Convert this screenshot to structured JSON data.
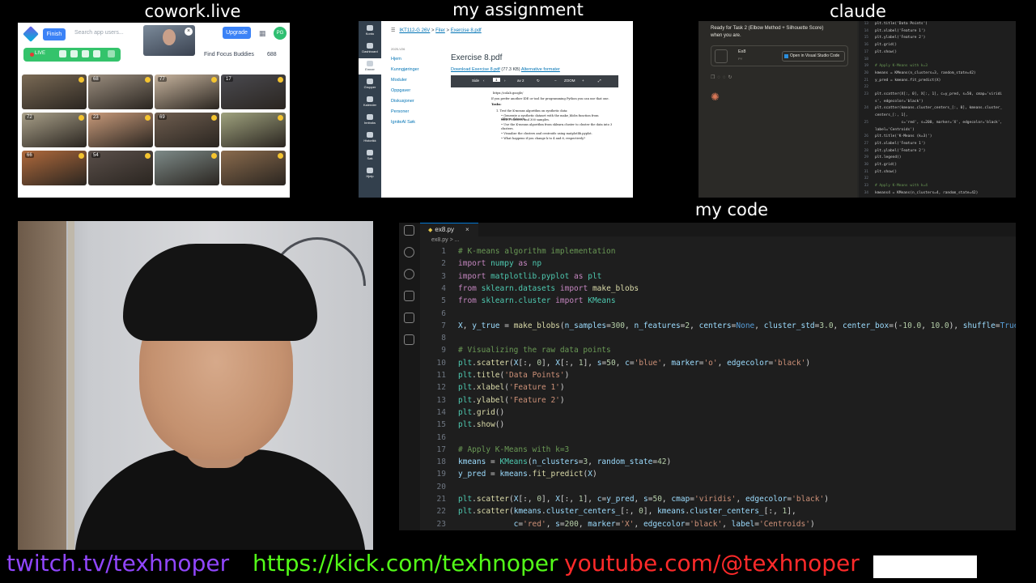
{
  "labels": {
    "cowork": "cowork.live",
    "assignment": "my assignment",
    "claude": "claude",
    "code": "my code"
  },
  "cowork": {
    "finish": "Finish",
    "search_placeholder": "Search app users...",
    "upgrade": "Upgrade",
    "avatar": "PG",
    "live": "LIVE",
    "find": "Find Focus Buddies",
    "count": "688",
    "tiles": [
      {
        "badge": "",
        "bg": "#7a6a55"
      },
      {
        "badge": "68",
        "bg": "#9a8d7e"
      },
      {
        "badge": "77",
        "bg": "#c7b49e"
      },
      {
        "badge": "17",
        "bg": "#4a4a50"
      },
      {
        "badge": "72",
        "bg": "#a9a089"
      },
      {
        "badge": "23",
        "bg": "#c89a7a"
      },
      {
        "badge": "69",
        "bg": "#6e5d4f"
      },
      {
        "badge": "",
        "bg": "#9fa27e"
      },
      {
        "badge": "66",
        "bg": "#b06a3c"
      },
      {
        "badge": "54",
        "bg": "#5a4f4a"
      },
      {
        "badge": "",
        "bg": "#7d8a88"
      },
      {
        "badge": "",
        "bg": "#8a6b4d"
      }
    ]
  },
  "assignment": {
    "sidebar": [
      "Konto",
      "Dashboard",
      "Emner",
      "Grupper",
      "Kalender",
      "Innboks",
      "Historikk",
      "Søk",
      "Hjelp"
    ],
    "breadcrumb": [
      "IKT112-G 26V",
      "Filer",
      "Exercise 8.pdf"
    ],
    "year": "2025-V26",
    "nav": [
      "Hjem",
      "Kunngjøringer",
      "Moduler",
      "Oppgaver",
      "Diskusjoner",
      "Personer",
      "IgniteAI Søk"
    ],
    "title": "Exercise 8.pdf",
    "download": "Download Exercise 8.pdf",
    "size": "(77.3 KB)",
    "alt": "Alternative formater",
    "pdf_side": "Side",
    "pdf_page": "1",
    "pdf_of": "av 2",
    "pdf_zoom": "ZOOM",
    "pdf_lines": [
      "https://colab.google/",
      "If you prefer another IDE or tool for programming Python you can use that one.",
      "Tasks:",
      "1. Test the K-means algorithm on synthetic data:",
      "• Generate a synthetic dataset with the make_blobs function from sklearn.datasets",
      "  with 3 clusters and 300 samples.",
      "• Use the K-means algorithm from sklearn.cluster to cluster the data into 3",
      "  clusters.",
      "• Visualize the clusters and centroids using matplotlib.pyplot.",
      "• What happens if you change k to 4 and 6, respectively?"
    ]
  },
  "claude": {
    "text1": "Ready for Task 2 (Elbow Method + Silhouette Score)",
    "text2": "when you are.",
    "file_name": "Ex8",
    "file_type": "PY",
    "open_btn": "Open in Visual Studio Code",
    "code_lines": [
      {
        "n": "13",
        "t": "plt.title('Data Points')"
      },
      {
        "n": "14",
        "t": "plt.xlabel('Feature 1')"
      },
      {
        "n": "15",
        "t": "plt.ylabel('Feature 2')"
      },
      {
        "n": "16",
        "t": "plt.grid()"
      },
      {
        "n": "17",
        "t": "plt.show()"
      },
      {
        "n": "18",
        "t": ""
      },
      {
        "n": "19",
        "t": "# Apply K-Means with k=3"
      },
      {
        "n": "20",
        "t": "kmeans = KMeans(n_clusters=3, random_state=42)"
      },
      {
        "n": "21",
        "t": "y_pred = kmeans.fit_predict(X)"
      },
      {
        "n": "22",
        "t": ""
      },
      {
        "n": "23",
        "t": "plt.scatter(X[:, 0], X[:, 1], c=y_pred, s=50, cmap='viridi"
      },
      {
        "n": "",
        "t": "s', edgecolor='black')"
      },
      {
        "n": "24",
        "t": "plt.scatter(kmeans.cluster_centers_[:, 0], kmeans.cluster_"
      },
      {
        "n": "",
        "t": "centers_[:, 1],"
      },
      {
        "n": "25",
        "t": "            c='red', s=200, marker='X', edgecolor='black',"
      },
      {
        "n": "",
        "t": "label='Centroids')"
      },
      {
        "n": "26",
        "t": "plt.title('K-Means (k=3)')"
      },
      {
        "n": "27",
        "t": "plt.xlabel('Feature 1')"
      },
      {
        "n": "28",
        "t": "plt.ylabel('Feature 2')"
      },
      {
        "n": "29",
        "t": "plt.legend()"
      },
      {
        "n": "30",
        "t": "plt.grid()"
      },
      {
        "n": "31",
        "t": "plt.show()"
      },
      {
        "n": "32",
        "t": ""
      },
      {
        "n": "33",
        "t": "# Apply K-Means with k=4"
      },
      {
        "n": "34",
        "t": "kmeans4 = KMeans(n_clusters=4, random_state=42)"
      }
    ]
  },
  "vscode": {
    "tab": "ex8.py",
    "breadcrumb": "ex8.py > ...",
    "lines": [
      {
        "n": "1",
        "segs": [
          [
            "c-com",
            "# K-means algorithm implementation"
          ]
        ]
      },
      {
        "n": "2",
        "segs": [
          [
            "c-kw",
            "import"
          ],
          [
            "",
            " "
          ],
          [
            "c-cls",
            "numpy"
          ],
          [
            "",
            " "
          ],
          [
            "c-kw",
            "as"
          ],
          [
            "",
            " "
          ],
          [
            "c-cls",
            "np"
          ]
        ]
      },
      {
        "n": "3",
        "segs": [
          [
            "c-kw",
            "import"
          ],
          [
            "",
            " "
          ],
          [
            "c-cls",
            "matplotlib.pyplot"
          ],
          [
            "",
            " "
          ],
          [
            "c-kw",
            "as"
          ],
          [
            "",
            " "
          ],
          [
            "c-cls",
            "plt"
          ]
        ]
      },
      {
        "n": "4",
        "segs": [
          [
            "c-kw",
            "from"
          ],
          [
            "",
            " "
          ],
          [
            "c-cls",
            "sklearn.datasets"
          ],
          [
            "",
            " "
          ],
          [
            "c-kw",
            "import"
          ],
          [
            "",
            " "
          ],
          [
            "c-fn",
            "make_blobs"
          ]
        ]
      },
      {
        "n": "5",
        "segs": [
          [
            "c-kw",
            "from"
          ],
          [
            "",
            " "
          ],
          [
            "c-cls",
            "sklearn.cluster"
          ],
          [
            "",
            " "
          ],
          [
            "c-kw",
            "import"
          ],
          [
            "",
            " "
          ],
          [
            "c-cls",
            "KMeans"
          ]
        ]
      },
      {
        "n": "6",
        "segs": []
      },
      {
        "n": "7",
        "segs": [
          [
            "c-var",
            "X"
          ],
          [
            "",
            ", "
          ],
          [
            "c-var",
            "y_true"
          ],
          [
            "",
            " = "
          ],
          [
            "c-fn",
            "make_blobs"
          ],
          [
            "",
            "("
          ],
          [
            "c-var",
            "n_samples"
          ],
          [
            "",
            "="
          ],
          [
            "c-num",
            "300"
          ],
          [
            "",
            ", "
          ],
          [
            "c-var",
            "n_features"
          ],
          [
            "",
            "="
          ],
          [
            "c-num",
            "2"
          ],
          [
            "",
            ", "
          ],
          [
            "c-var",
            "centers"
          ],
          [
            "",
            "="
          ],
          [
            "c-const",
            "None"
          ],
          [
            "",
            ", "
          ],
          [
            "c-var",
            "cluster_std"
          ],
          [
            "",
            "="
          ],
          [
            "c-num",
            "3.0"
          ],
          [
            "",
            ", "
          ],
          [
            "c-var",
            "center_box"
          ],
          [
            "",
            "=(-"
          ],
          [
            "c-num",
            "10.0"
          ],
          [
            "",
            ", "
          ],
          [
            "c-num",
            "10.0"
          ],
          [
            "",
            "), "
          ],
          [
            "c-var",
            "shuffle"
          ],
          [
            "",
            "="
          ],
          [
            "c-const",
            "True"
          ],
          [
            "",
            ", "
          ]
        ]
      },
      {
        "n": "8",
        "segs": []
      },
      {
        "n": "9",
        "segs": [
          [
            "c-com",
            "# Visualizing the raw data points"
          ]
        ]
      },
      {
        "n": "10",
        "segs": [
          [
            "c-cls",
            "plt"
          ],
          [
            "",
            "."
          ],
          [
            "c-fn",
            "scatter"
          ],
          [
            "",
            "("
          ],
          [
            "c-var",
            "X"
          ],
          [
            "",
            "[:, "
          ],
          [
            "c-num",
            "0"
          ],
          [
            "",
            "], "
          ],
          [
            "c-var",
            "X"
          ],
          [
            "",
            "[:, "
          ],
          [
            "c-num",
            "1"
          ],
          [
            "",
            "], "
          ],
          [
            "c-var",
            "s"
          ],
          [
            "",
            "="
          ],
          [
            "c-num",
            "50"
          ],
          [
            "",
            ", "
          ],
          [
            "c-var",
            "c"
          ],
          [
            "",
            "="
          ],
          [
            "c-str",
            "'blue'"
          ],
          [
            "",
            ", "
          ],
          [
            "c-var",
            "marker"
          ],
          [
            "",
            "="
          ],
          [
            "c-str",
            "'o'"
          ],
          [
            "",
            ", "
          ],
          [
            "c-var",
            "edgecolor"
          ],
          [
            "",
            "="
          ],
          [
            "c-str",
            "'black'"
          ],
          [
            "",
            ")"
          ]
        ]
      },
      {
        "n": "11",
        "segs": [
          [
            "c-cls",
            "plt"
          ],
          [
            "",
            "."
          ],
          [
            "c-fn",
            "title"
          ],
          [
            "",
            "("
          ],
          [
            "c-str",
            "'Data Points'"
          ],
          [
            "",
            ")"
          ]
        ]
      },
      {
        "n": "12",
        "segs": [
          [
            "c-cls",
            "plt"
          ],
          [
            "",
            "."
          ],
          [
            "c-fn",
            "xlabel"
          ],
          [
            "",
            "("
          ],
          [
            "c-str",
            "'Feature 1'"
          ],
          [
            "",
            ")"
          ]
        ]
      },
      {
        "n": "13",
        "segs": [
          [
            "c-cls",
            "plt"
          ],
          [
            "",
            "."
          ],
          [
            "c-fn",
            "ylabel"
          ],
          [
            "",
            "("
          ],
          [
            "c-str",
            "'Feature 2'"
          ],
          [
            "",
            ")"
          ]
        ]
      },
      {
        "n": "14",
        "segs": [
          [
            "c-cls",
            "plt"
          ],
          [
            "",
            "."
          ],
          [
            "c-fn",
            "grid"
          ],
          [
            "",
            "()"
          ]
        ]
      },
      {
        "n": "15",
        "segs": [
          [
            "c-cls",
            "plt"
          ],
          [
            "",
            "."
          ],
          [
            "c-fn",
            "show"
          ],
          [
            "",
            "()"
          ]
        ]
      },
      {
        "n": "16",
        "segs": []
      },
      {
        "n": "17",
        "segs": [
          [
            "c-com",
            "# Apply K-Means with k=3"
          ]
        ]
      },
      {
        "n": "18",
        "segs": [
          [
            "c-var",
            "kmeans"
          ],
          [
            "",
            " = "
          ],
          [
            "c-cls",
            "KMeans"
          ],
          [
            "",
            "("
          ],
          [
            "c-var",
            "n_clusters"
          ],
          [
            "",
            "="
          ],
          [
            "c-num",
            "3"
          ],
          [
            "",
            ", "
          ],
          [
            "c-var",
            "random_state"
          ],
          [
            "",
            "="
          ],
          [
            "c-num",
            "42"
          ],
          [
            "",
            ")"
          ]
        ]
      },
      {
        "n": "19",
        "segs": [
          [
            "c-var",
            "y_pred"
          ],
          [
            "",
            " = "
          ],
          [
            "c-var",
            "kmeans"
          ],
          [
            "",
            "."
          ],
          [
            "c-fn",
            "fit_predict"
          ],
          [
            "",
            "("
          ],
          [
            "c-var",
            "X"
          ],
          [
            "",
            ")"
          ]
        ]
      },
      {
        "n": "20",
        "segs": []
      },
      {
        "n": "21",
        "segs": [
          [
            "c-cls",
            "plt"
          ],
          [
            "",
            "."
          ],
          [
            "c-fn",
            "scatter"
          ],
          [
            "",
            "("
          ],
          [
            "c-var",
            "X"
          ],
          [
            "",
            "[:, "
          ],
          [
            "c-num",
            "0"
          ],
          [
            "",
            "], "
          ],
          [
            "c-var",
            "X"
          ],
          [
            "",
            "[:, "
          ],
          [
            "c-num",
            "1"
          ],
          [
            "",
            "], "
          ],
          [
            "c-var",
            "c"
          ],
          [
            "",
            "="
          ],
          [
            "c-var",
            "y_pred"
          ],
          [
            "",
            ", "
          ],
          [
            "c-var",
            "s"
          ],
          [
            "",
            "="
          ],
          [
            "c-num",
            "50"
          ],
          [
            "",
            ", "
          ],
          [
            "c-var",
            "cmap"
          ],
          [
            "",
            "="
          ],
          [
            "c-str",
            "'viridis'"
          ],
          [
            "",
            ", "
          ],
          [
            "c-var",
            "edgecolor"
          ],
          [
            "",
            "="
          ],
          [
            "c-str",
            "'black'"
          ],
          [
            "",
            ")"
          ]
        ]
      },
      {
        "n": "22",
        "segs": [
          [
            "c-cls",
            "plt"
          ],
          [
            "",
            "."
          ],
          [
            "c-fn",
            "scatter"
          ],
          [
            "",
            "("
          ],
          [
            "c-var",
            "kmeans"
          ],
          [
            "",
            "."
          ],
          [
            "c-var",
            "cluster_centers_"
          ],
          [
            "",
            "[:, "
          ],
          [
            "c-num",
            "0"
          ],
          [
            "",
            "], "
          ],
          [
            "c-var",
            "kmeans"
          ],
          [
            "",
            "."
          ],
          [
            "c-var",
            "cluster_centers_"
          ],
          [
            "",
            "[:, "
          ],
          [
            "c-num",
            "1"
          ],
          [
            "",
            "],"
          ]
        ]
      },
      {
        "n": "23",
        "segs": [
          [
            "",
            "            "
          ],
          [
            "c-var",
            "c"
          ],
          [
            "",
            "="
          ],
          [
            "c-str",
            "'red'"
          ],
          [
            "",
            ", "
          ],
          [
            "c-var",
            "s"
          ],
          [
            "",
            "="
          ],
          [
            "c-num",
            "200"
          ],
          [
            "",
            ", "
          ],
          [
            "c-var",
            "marker"
          ],
          [
            "",
            "="
          ],
          [
            "c-str",
            "'X'"
          ],
          [
            "",
            ", "
          ],
          [
            "c-var",
            "edgecolor"
          ],
          [
            "",
            "="
          ],
          [
            "c-str",
            "'black'"
          ],
          [
            "",
            ", "
          ],
          [
            "c-var",
            "label"
          ],
          [
            "",
            "="
          ],
          [
            "c-str",
            "'Centroids'"
          ],
          [
            "",
            ")"
          ]
        ]
      }
    ]
  },
  "links": {
    "twitch": "twitch.tv/texhnoper",
    "kick": "https://kick.com/texhnoper",
    "youtube": "youtube.com/@texhnoper"
  },
  "colors": {
    "twitch": "#9146ff",
    "kick": "#53fc18",
    "youtube": "#ff2a2a"
  }
}
